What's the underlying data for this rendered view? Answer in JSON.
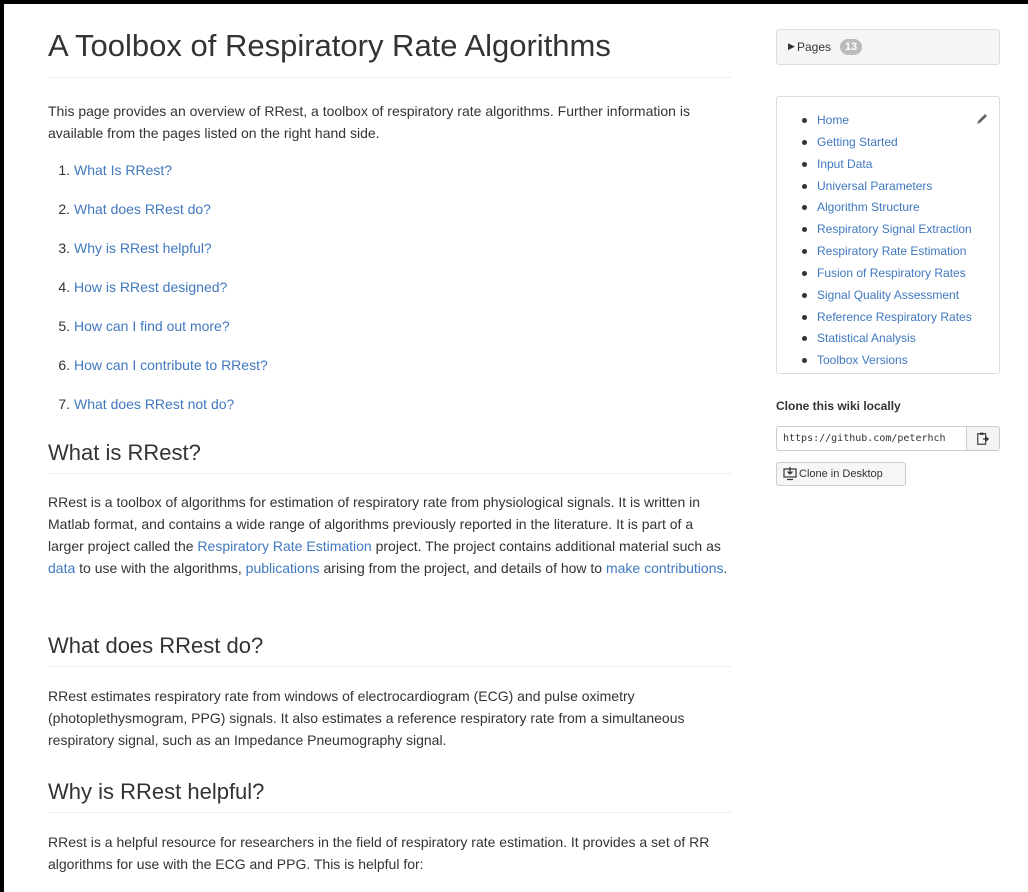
{
  "page": {
    "title": "A Toolbox of Respiratory Rate Algorithms",
    "intro": "This page provides an overview of RRest, a toolbox of respiratory rate algorithms. Further information is available from the pages listed on the right hand side.",
    "toc": [
      {
        "num": "1.",
        "label": "What Is RRest?"
      },
      {
        "num": "2.",
        "label": "What does RRest do?"
      },
      {
        "num": "3.",
        "label": "Why is RRest helpful?"
      },
      {
        "num": "4.",
        "label": "How is RRest designed?"
      },
      {
        "num": "5.",
        "label": "How can I find out more?"
      },
      {
        "num": "6.",
        "label": "How can I contribute to RRest?"
      },
      {
        "num": "7.",
        "label": "What does RRest not do?"
      }
    ],
    "sections": {
      "what_is": {
        "heading": "What is RRest?",
        "t1": "RRest is a toolbox of algorithms for estimation of respiratory rate from physiological signals. It is written in Matlab format, and contains a wide range of algorithms previously reported in the literature. It is part of a larger project called the ",
        "link1": "Respiratory Rate Estimation",
        "t2": " project. The project contains additional material such as ",
        "link2": "data",
        "t3": " to use with the algorithms, ",
        "link3": "publications",
        "t4": " arising from the project, and details of how to ",
        "link4": "make contributions",
        "t5": "."
      },
      "what_does": {
        "heading": "What does RRest do?",
        "body": "RRest estimates respiratory rate from windows of electrocardiogram (ECG) and pulse oximetry (photoplethysmogram, PPG) signals. It also estimates a reference respiratory rate from a simultaneous respiratory signal, such as an Impedance Pneumography signal."
      },
      "why_helpful": {
        "heading": "Why is RRest helpful?",
        "body": "RRest is a helpful resource for researchers in the field of respiratory rate estimation. It provides a set of RR algorithms for use with the ECG and PPG. This is helpful for:"
      }
    }
  },
  "sidebar": {
    "pages_label": "Pages",
    "pages_count": "13",
    "pages": [
      "Home",
      "Getting Started",
      "Input Data",
      "Universal Parameters",
      "Algorithm Structure",
      "Respiratory Signal Extraction",
      "Respiratory Rate Estimation",
      "Fusion of Respiratory Rates",
      "Signal Quality Assessment",
      "Reference Respiratory Rates",
      "Statistical Analysis",
      "Toolbox Versions"
    ],
    "clone_title": "Clone this wiki locally",
    "clone_url": "https://github.com/peterhch",
    "clone_desktop_label": "Clone in Desktop"
  },
  "icons": {
    "edit": "pencil-icon",
    "clipboard": "clipboard-icon",
    "desktop": "desktop-download-icon",
    "caret": "triangle-right-icon"
  },
  "colors": {
    "link": "#4078c0",
    "text": "#333333",
    "border": "#dddddd",
    "counter_bg": "#bbbbbb"
  }
}
